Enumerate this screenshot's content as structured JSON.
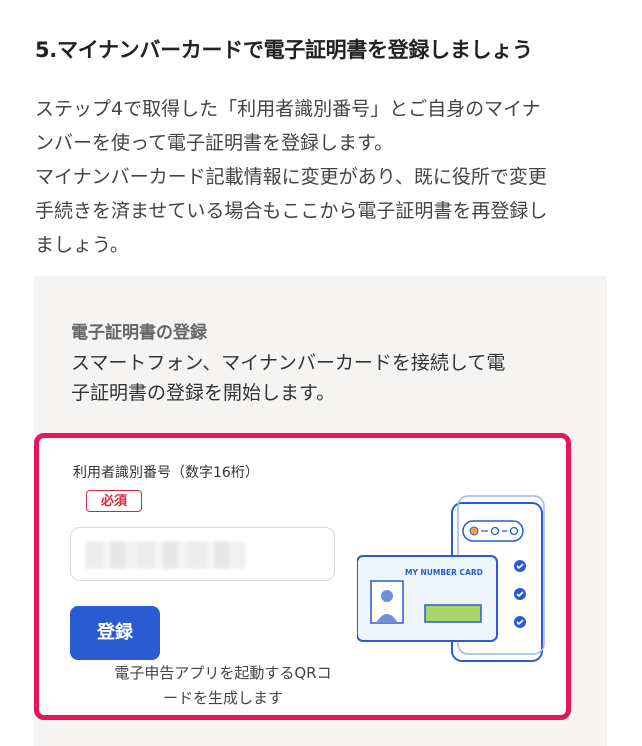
{
  "heading": "5.マイナンバーカードで電子証明書を登録しましょう",
  "intro": {
    "line1": "ステップ4で取得した「利用者識別番号」とご自身のマイナ",
    "line2": "ンバーを使って電子証明書を登録します。",
    "line3": "マイナンバーカード記載情報に変更があり、既に役所で変更",
    "line4": "手続きを済ませている場合もここから電子証明書を再登録し",
    "line5": "ましょう。"
  },
  "panel": {
    "title": "電子証明書の登録",
    "desc_line1": "スマートフォン、マイナンバーカードを接続して電",
    "desc_line2": "子証明書の登録を開始します。"
  },
  "form": {
    "label": "利用者識別番号（数字16桁）",
    "required_badge": "必須",
    "submit_label": "登録",
    "note_line1": "電子申告アプリを起動するQRコ",
    "note_line2": "ードを生成します"
  },
  "illustration": {
    "card_text": "MY NUMBER CARD"
  },
  "colors": {
    "highlight_border": "#e8155e",
    "button": "#2a5bd2",
    "badge": "#d4293d",
    "illustration_line": "#2a5bd2"
  }
}
